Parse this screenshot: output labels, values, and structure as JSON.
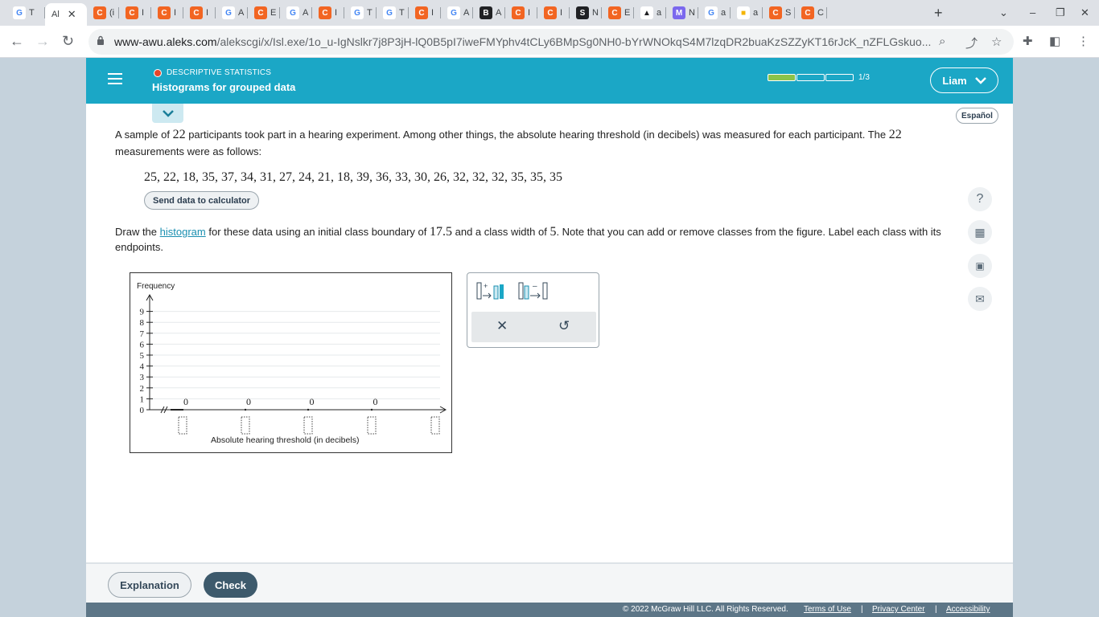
{
  "browser": {
    "tabs": [
      {
        "favicon": "G",
        "fav_color": "#ffffff",
        "fav_text": "#4285f4",
        "label": "T"
      },
      {
        "favicon": "",
        "fav_color": "#ffffff",
        "fav_text": "#202124",
        "label": "Al",
        "active": true
      },
      {
        "favicon": "C",
        "fav_color": "#f26522",
        "fav_text": "#ffffff",
        "label": "(i"
      },
      {
        "favicon": "C",
        "fav_color": "#f26522",
        "fav_text": "#ffffff",
        "label": "I"
      },
      {
        "favicon": "C",
        "fav_color": "#f26522",
        "fav_text": "#ffffff",
        "label": "I"
      },
      {
        "favicon": "C",
        "fav_color": "#f26522",
        "fav_text": "#ffffff",
        "label": "I"
      },
      {
        "favicon": "G",
        "fav_color": "#ffffff",
        "fav_text": "#4285f4",
        "label": "A"
      },
      {
        "favicon": "C",
        "fav_color": "#f26522",
        "fav_text": "#ffffff",
        "label": "E"
      },
      {
        "favicon": "G",
        "fav_color": "#ffffff",
        "fav_text": "#4285f4",
        "label": "A"
      },
      {
        "favicon": "C",
        "fav_color": "#f26522",
        "fav_text": "#ffffff",
        "label": "I"
      },
      {
        "favicon": "G",
        "fav_color": "#ffffff",
        "fav_text": "#4285f4",
        "label": "T"
      },
      {
        "favicon": "G",
        "fav_color": "#ffffff",
        "fav_text": "#4285f4",
        "label": "T"
      },
      {
        "favicon": "C",
        "fav_color": "#f26522",
        "fav_text": "#ffffff",
        "label": "I"
      },
      {
        "favicon": "G",
        "fav_color": "#ffffff",
        "fav_text": "#4285f4",
        "label": "A"
      },
      {
        "favicon": "B",
        "fav_color": "#202124",
        "fav_text": "#ffffff",
        "label": "A"
      },
      {
        "favicon": "C",
        "fav_color": "#f26522",
        "fav_text": "#ffffff",
        "label": "I"
      },
      {
        "favicon": "C",
        "fav_color": "#f26522",
        "fav_text": "#ffffff",
        "label": "I"
      },
      {
        "favicon": "S",
        "fav_color": "#202124",
        "fav_text": "#ffffff",
        "label": "N"
      },
      {
        "favicon": "C",
        "fav_color": "#f26522",
        "fav_text": "#ffffff",
        "label": "E"
      },
      {
        "favicon": "▲",
        "fav_color": "#ffffff",
        "fav_text": "#202124",
        "label": "a"
      },
      {
        "favicon": "M",
        "fav_color": "#7b68ee",
        "fav_text": "#ffffff",
        "label": "N"
      },
      {
        "favicon": "G",
        "fav_color": "#ffffff",
        "fav_text": "#4285f4",
        "label": "a"
      },
      {
        "favicon": "■",
        "fav_color": "#ffffff",
        "fav_text": "#f4b400",
        "label": "a"
      },
      {
        "favicon": "C",
        "fav_color": "#f26522",
        "fav_text": "#ffffff",
        "label": "S"
      },
      {
        "favicon": "C",
        "fav_color": "#f26522",
        "fav_text": "#ffffff",
        "label": "C"
      }
    ],
    "url_host": "www-awu.aleks.com",
    "url_path": "/alekscgi/x/Isl.exe/1o_u-IgNslkr7j8P3jH-lQ0B5pI7iweFMYphv4tCLy6BMpSg0NH0-bYrWNOkqS4M7lzqDR2buaKzSZZyKT16rJcK_nZFLGskuo..."
  },
  "header": {
    "topic": "DESCRIPTIVE STATISTICS",
    "title": "Histograms for grouped data",
    "progress_text": "1/3",
    "progress_done": 1,
    "progress_total": 3,
    "user": "Liam",
    "language": "Español"
  },
  "problem": {
    "p1": "A sample of",
    "n1": "22",
    "p2": "participants took part in a hearing experiment. Among other things, the absolute hearing threshold (in decibels) was measured for each participant. The",
    "n2": "22",
    "p3": "measurements were as follows:",
    "data": "25, 22, 18, 35, 37, 34, 31, 27, 24, 21, 18, 39, 36, 33, 30, 26, 32, 32, 32, 35, 35, 35",
    "send_button": "Send data to calculator",
    "i1": "Draw the",
    "i_link": "histogram",
    "i2": "for these data using an initial class boundary of",
    "boundary": "17.5",
    "i3": "and a class width of",
    "width": "5",
    "i4": ". Note that you can add or remove classes from the figure. Label each class with its endpoints."
  },
  "graph": {
    "ylabel": "Frequency",
    "xlabel": "Absolute hearing threshold (in decibels)",
    "yticks": [
      "0",
      "1",
      "2",
      "3",
      "4",
      "5",
      "6",
      "7",
      "8",
      "9"
    ],
    "bar_values": [
      "0",
      "0",
      "0",
      "0"
    ]
  },
  "footer": {
    "explanation": "Explanation",
    "check": "Check",
    "copyright": "© 2022 McGraw Hill LLC. All Rights Reserved.",
    "terms": "Terms of Use",
    "privacy": "Privacy Center",
    "accessibility": "Accessibility"
  },
  "colors": {
    "brand": "#1ba7c6",
    "progress_done": "#8bc34a",
    "check_button": "#3d5a6c"
  }
}
